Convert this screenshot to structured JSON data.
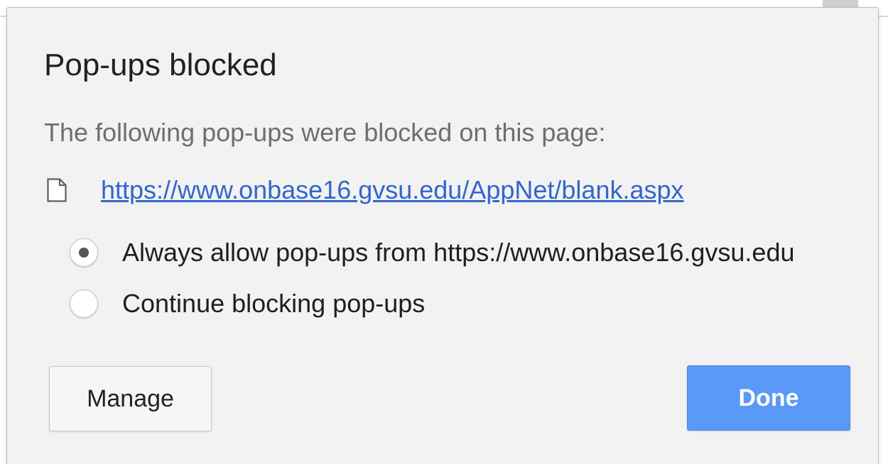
{
  "dialog": {
    "title": "Pop-ups blocked",
    "message": "The following pop-ups were blocked on this page:",
    "blocked_popups": [
      {
        "url": "https://www.onbase16.gvsu.edu/AppNet/blank.aspx",
        "icon": "document-icon"
      }
    ],
    "options": [
      {
        "label": "Always allow pop-ups from https://www.onbase16.gvsu.edu",
        "selected": true
      },
      {
        "label": "Continue blocking pop-ups",
        "selected": false
      }
    ],
    "buttons": {
      "manage_label": "Manage",
      "done_label": "Done"
    }
  },
  "colors": {
    "link": "#3366cc",
    "primary_button": "#5a99f7",
    "bubble_background": "#f2f2f2"
  }
}
